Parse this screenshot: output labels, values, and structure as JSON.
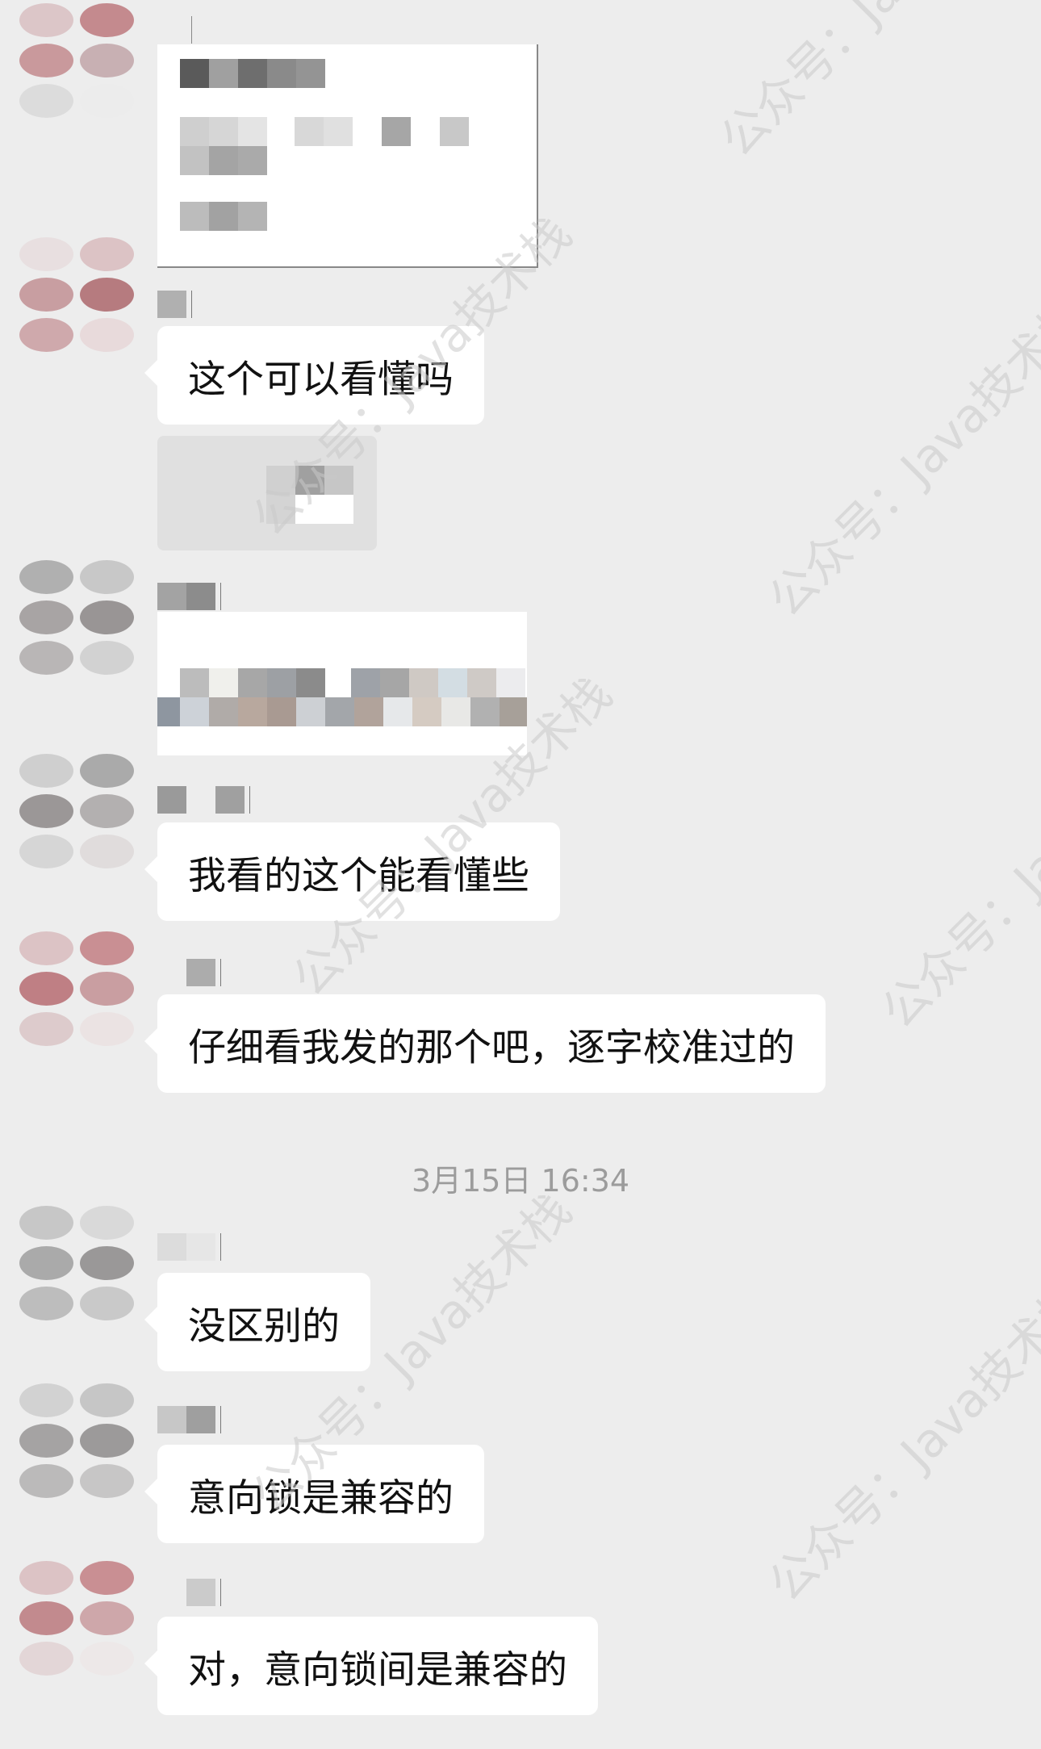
{
  "watermark": "公众号：Java技术栈",
  "messages": {
    "m1": "这个可以看懂吗",
    "m2": "我看的这个能看懂些",
    "m3": "仔细看我发的那个吧，逐字校准过的",
    "m4": "没区别的",
    "m5": "意向锁是兼容的",
    "m6": "对，意向锁间是兼容的"
  },
  "timestamp": "3月15日 16:34",
  "colors": {
    "background": "#ededed",
    "bubble": "#ffffff",
    "text": "#111111",
    "timestamp": "#9c9c9c"
  }
}
